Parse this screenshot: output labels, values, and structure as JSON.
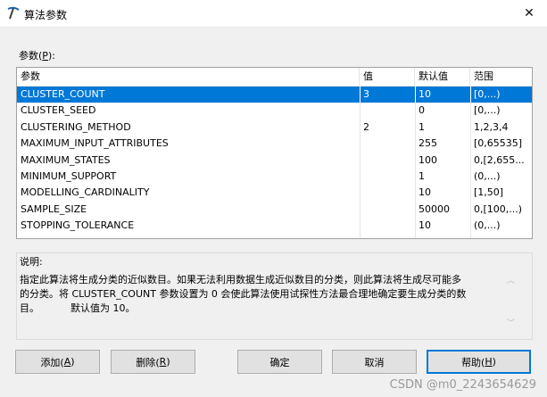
{
  "window": {
    "title": "算法参数",
    "close_glyph": "✕"
  },
  "params_label": {
    "text": "参数(",
    "key": "P",
    "suffix": "):"
  },
  "table": {
    "headers": [
      "参数",
      "值",
      "默认值",
      "范围"
    ],
    "rows": [
      {
        "param": "CLUSTER_COUNT",
        "value": "3",
        "default": "10",
        "range": "[0,...)",
        "selected": true
      },
      {
        "param": "CLUSTER_SEED",
        "value": "",
        "default": "0",
        "range": "[0,...)"
      },
      {
        "param": "CLUSTERING_METHOD",
        "value": "2",
        "default": "1",
        "range": "1,2,3,4"
      },
      {
        "param": "MAXIMUM_INPUT_ATTRIBUTES",
        "value": "",
        "default": "255",
        "range": "[0,65535]"
      },
      {
        "param": "MAXIMUM_STATES",
        "value": "",
        "default": "100",
        "range": "0,[2,655..."
      },
      {
        "param": "MINIMUM_SUPPORT",
        "value": "",
        "default": "1",
        "range": "(0,...)"
      },
      {
        "param": "MODELLING_CARDINALITY",
        "value": "",
        "default": "10",
        "range": "[1,50]"
      },
      {
        "param": "SAMPLE_SIZE",
        "value": "",
        "default": "50000",
        "range": "0,[100,...)"
      },
      {
        "param": "STOPPING_TOLERANCE",
        "value": "",
        "default": "10",
        "range": "(0,...)"
      }
    ]
  },
  "description": {
    "label": "说明:",
    "line1": "指定此算法将生成分类的近似数目。如果无法利用数据生成近似数目的分类，则此算法将生成尽可能多",
    "line2": "的分类。将 CLUSTER_COUNT 参数设置为 0 会使此算法使用试探性方法最合理地确定要生成分类的数",
    "line3": "目。          默认值为 10。"
  },
  "buttons": {
    "add": {
      "text": "添加(",
      "key": "A",
      "suffix": ")"
    },
    "delete": {
      "text": "删除(",
      "key": "R",
      "suffix": ")"
    },
    "ok": {
      "text": "确定"
    },
    "cancel": {
      "text": "取消"
    },
    "help": {
      "text": "帮助(",
      "key": "H",
      "suffix": ")"
    }
  },
  "watermark": "CSDN @m0_2243654629",
  "colors": {
    "selection": "#0078d7",
    "default_button_border": "#0078d7"
  }
}
